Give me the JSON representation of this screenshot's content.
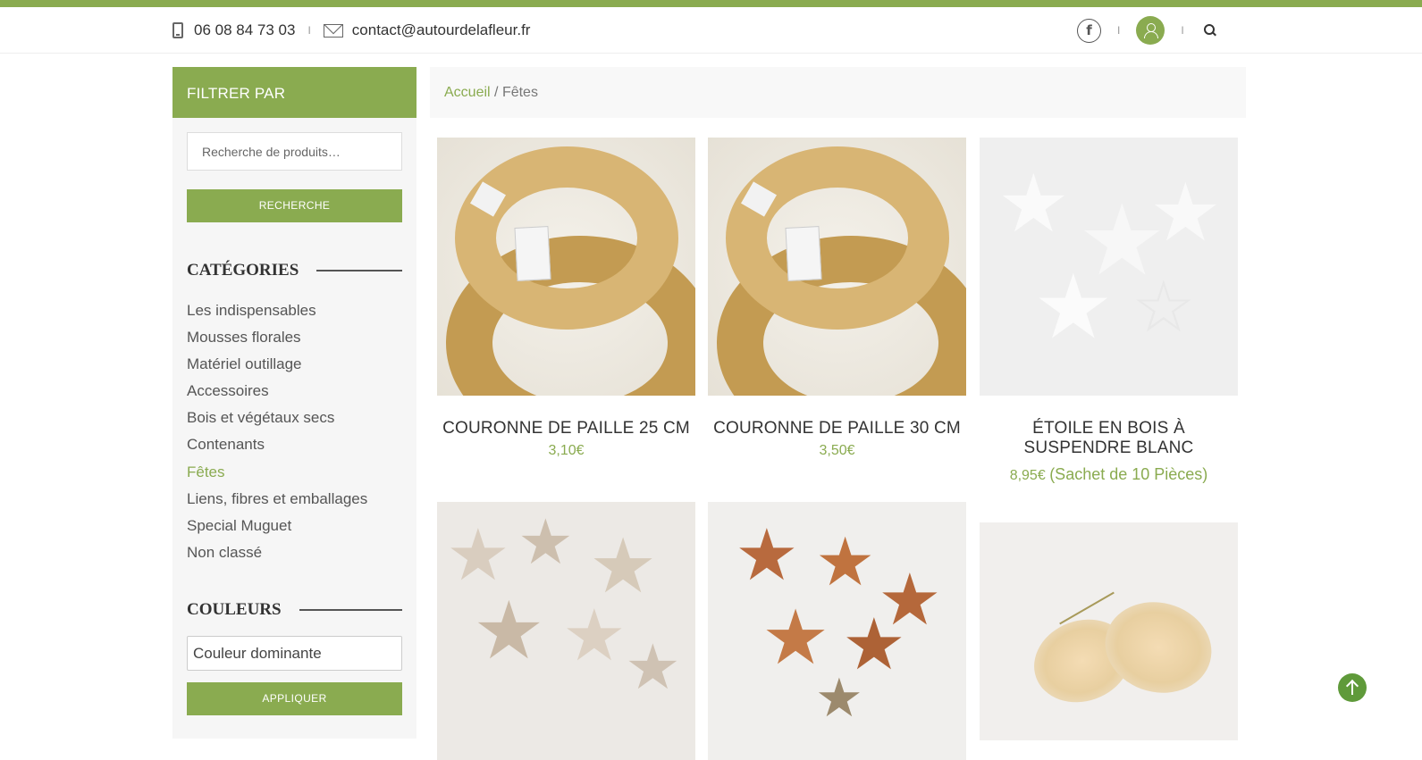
{
  "header": {
    "phone": "06 08 84 73 03",
    "email": "contact@autourdelafleur.fr",
    "separator": "I",
    "facebook_glyph": "f"
  },
  "sidebar": {
    "filter_title": "FILTRER PAR",
    "search_placeholder": "Recherche de produits…",
    "search_button": "RECHERCHE",
    "categories_title": "CATÉGORIES",
    "categories": [
      {
        "label": "Les indispensables",
        "active": false
      },
      {
        "label": "Mousses florales",
        "active": false
      },
      {
        "label": "Matériel outillage",
        "active": false
      },
      {
        "label": "Accessoires",
        "active": false
      },
      {
        "label": "Bois et végétaux secs",
        "active": false
      },
      {
        "label": "Contenants",
        "active": false
      },
      {
        "label": "Fêtes",
        "active": true
      },
      {
        "label": "Liens, fibres et emballages",
        "active": false
      },
      {
        "label": "Special Muguet",
        "active": false
      },
      {
        "label": "Non classé",
        "active": false
      }
    ],
    "colors_title": "COULEURS",
    "color_select_value": "Couleur dominante",
    "apply_button": "APPLIQUER"
  },
  "breadcrumb": {
    "home": "Accueil",
    "separator": "/",
    "current": "Fêtes"
  },
  "products": [
    {
      "title": "COURONNE DE PAILLE 25 CM",
      "price": "3,10€",
      "note": ""
    },
    {
      "title": "COURONNE DE PAILLE 30 CM",
      "price": "3,50€",
      "note": ""
    },
    {
      "title_line1": "ÉTOILE EN BOIS À",
      "title_line2": "SUSPENDRE BLANC",
      "price": "8,95€",
      "note": "(Sachet de 10 Pièces)"
    },
    {
      "title": "",
      "price": "",
      "note": ""
    },
    {
      "title": "",
      "price": "",
      "note": ""
    },
    {
      "title": "",
      "price": "",
      "note": ""
    }
  ],
  "colors": {
    "accent": "#8aab50",
    "scroll_top": "#5f9a3a"
  }
}
